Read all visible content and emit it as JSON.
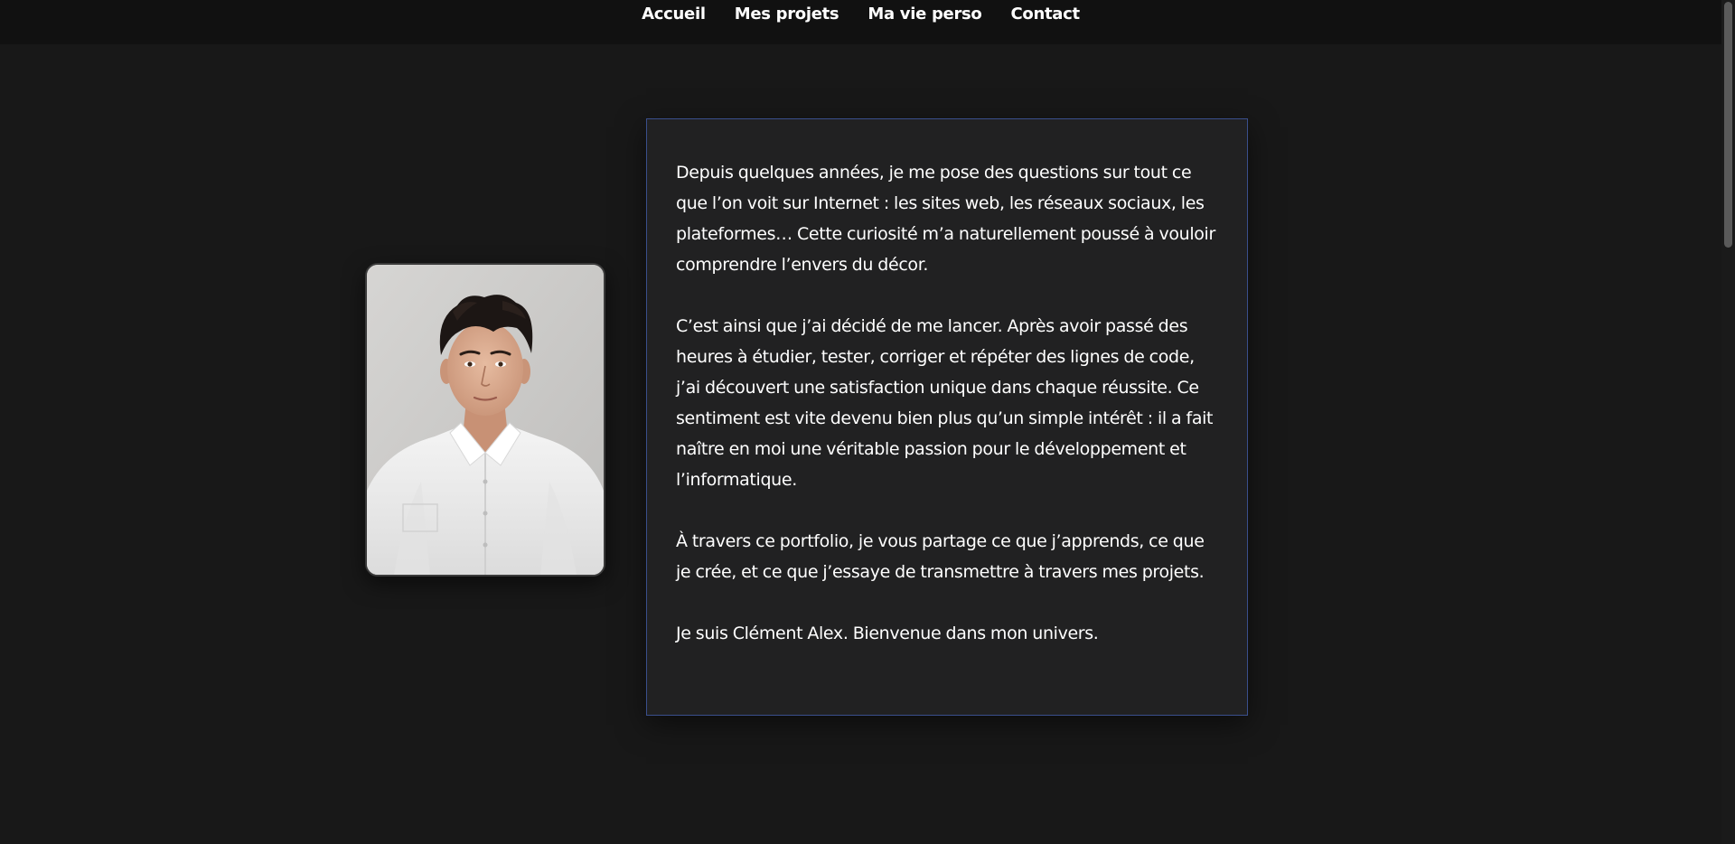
{
  "nav": {
    "items": [
      {
        "label": "Accueil"
      },
      {
        "label": "Mes projets"
      },
      {
        "label": "Ma vie perso"
      },
      {
        "label": "Contact"
      }
    ]
  },
  "profile": {
    "photo_icon": "portrait-photo"
  },
  "intro": {
    "paragraphs": [
      "Depuis quelques années, je me pose des questions sur tout ce que l’on voit sur Internet : les sites web, les réseaux sociaux, les plateformes… Cette curiosité m’a naturellement poussé à vouloir comprendre l’envers du décor.",
      "C’est ainsi que j’ai décidé de me lancer. Après avoir passé des heures à étudier, tester, corriger et répéter des lignes de code, j’ai découvert une satisfaction unique dans chaque réussite. Ce sentiment est vite devenu bien plus qu’un simple intérêt : il a fait naître en moi une véritable passion pour le développement et l’informatique.",
      "À travers ce portfolio, je vous partage ce que j’apprends, ce que je crée, et ce que j’essaye de transmettre à travers mes projets.",
      "Je suis Clément Alex. Bienvenue dans mon univers."
    ]
  },
  "colors": {
    "background": "#181818",
    "nav_background": "#111111",
    "card_background": "#212122",
    "card_border": "#3a4f8c"
  }
}
